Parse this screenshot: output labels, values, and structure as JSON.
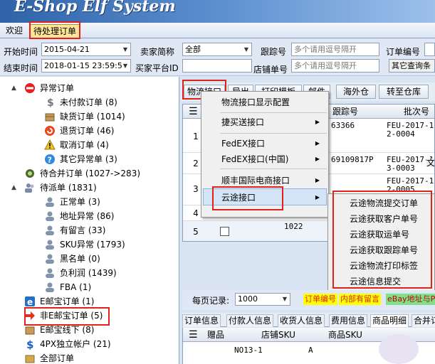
{
  "app": {
    "title": "E-Shop Elf System"
  },
  "tabs": [
    {
      "label": "欢迎"
    },
    {
      "label": "待处理订单"
    }
  ],
  "filters": {
    "start_time_label": "开始时间",
    "start_time_value": "2015-04-21",
    "end_time_label": "结束时间",
    "end_time_value": "2018-01-15 23:59:5",
    "seller_label": "卖家简称",
    "seller_value": "全部",
    "platform_id_label": "买家平台ID",
    "tracking_label": "跟踪号",
    "tracking_placeholder": "多个请用逗号隔开",
    "store_order_label": "店铺单号",
    "store_order_placeholder": "多个请用逗号隔开",
    "order_no_label": "订单编号",
    "other_query_label": "其它查询条"
  },
  "tree": {
    "exception_orders": "异常订单",
    "unpaid": "未付款订单 (8)",
    "out_of_stock": "缺货订单 (1014)",
    "returns": "退货订单 (46)",
    "cancelled": "取消订单 (4)",
    "other_exception": "其它异常单 (3)",
    "pending_merge": "待合并订单 (1027->283)",
    "pending_dispatch": "待派单 (1831)",
    "normal": "正常单 (3)",
    "address_error": "地址异常 (86)",
    "has_message": "有留言 (33)",
    "sku_error": "SKU异常 (1793)",
    "blacklist": "黑名单 (0)",
    "negative_profit": "负利润 (1439)",
    "fba": "FBA (1)",
    "ebay_orders": "E邮宝订单 (1)",
    "non_ebay_orders": "非E邮宝订单 (5)",
    "ebay_offline": "E邮宝线下 (8)",
    "fourpx_account": "4PX独立帐户 (21)",
    "all_orders": "全部订单"
  },
  "toolbar": {
    "logistics_interface": "物流接口",
    "export": "导出",
    "print_template": "打印模板",
    "mail": "邮件",
    "overseas_warehouse": "海外仓",
    "transfer_warehouse": "转至仓库"
  },
  "grid": {
    "col_tracking": "跟踪号",
    "col_batch": "批次号",
    "rows": [
      {
        "num": "1",
        "tracking": "63366",
        "batch1": "FEU-2017-11",
        "batch2": "2-0004"
      },
      {
        "num": "2",
        "tracking": "69109817P",
        "batch1": "FEU-2017-11",
        "batch2": "3-0003"
      },
      {
        "num": "3",
        "tracking": "",
        "batch1": "FEU-2017-11",
        "batch2": "2-0005"
      },
      {
        "num": "4",
        "tracking": "",
        "batch1": "",
        "batch2": ""
      },
      {
        "num": "5",
        "tracking": "",
        "value": "1022",
        "batch1": "",
        "batch2": ""
      }
    ],
    "overflow_text": "文"
  },
  "context_menu": {
    "items": [
      {
        "label": "物流接口显示配置"
      },
      {
        "label": "捷买送接口"
      },
      {
        "label": "FedEX接口"
      },
      {
        "label": "FedEX接口(中国)"
      },
      {
        "label": "顺丰国际电商接口"
      },
      {
        "label": "云途接口"
      }
    ],
    "submenu": [
      {
        "label": "云途物流提交订单"
      },
      {
        "label": "云途获取客户单号"
      },
      {
        "label": "云途获取运单号"
      },
      {
        "label": "云途获取跟踪单号"
      },
      {
        "label": "云途物流打印标签"
      },
      {
        "label": "云途信息提交"
      }
    ]
  },
  "pager": {
    "per_page_label": "每页记录:",
    "per_page_value": "1000",
    "tag_order_no": "订单编号",
    "tag_internal_note": "内部有留言",
    "tag_ebay_addr": "eBay地址与P"
  },
  "detail_tabs": [
    {
      "label": "订单信息"
    },
    {
      "label": "付款人信息"
    },
    {
      "label": "收货人信息"
    },
    {
      "label": "费用信息"
    },
    {
      "label": "商品明细"
    },
    {
      "label": "合并订"
    }
  ],
  "detail_grid": {
    "col_gift": "赠品",
    "col_store_sku": "店铺SKU",
    "col_product_sku": "商品SKU",
    "row_store_sku": "NO13-1",
    "row_product_sku": "A"
  },
  "colors": {
    "highlight_red": "#e0221b",
    "banner_blue": "#2f63a8",
    "tag_red": "#e0221b",
    "tag_yellow": "#ffff00",
    "tag_green": "#7fe08a"
  }
}
